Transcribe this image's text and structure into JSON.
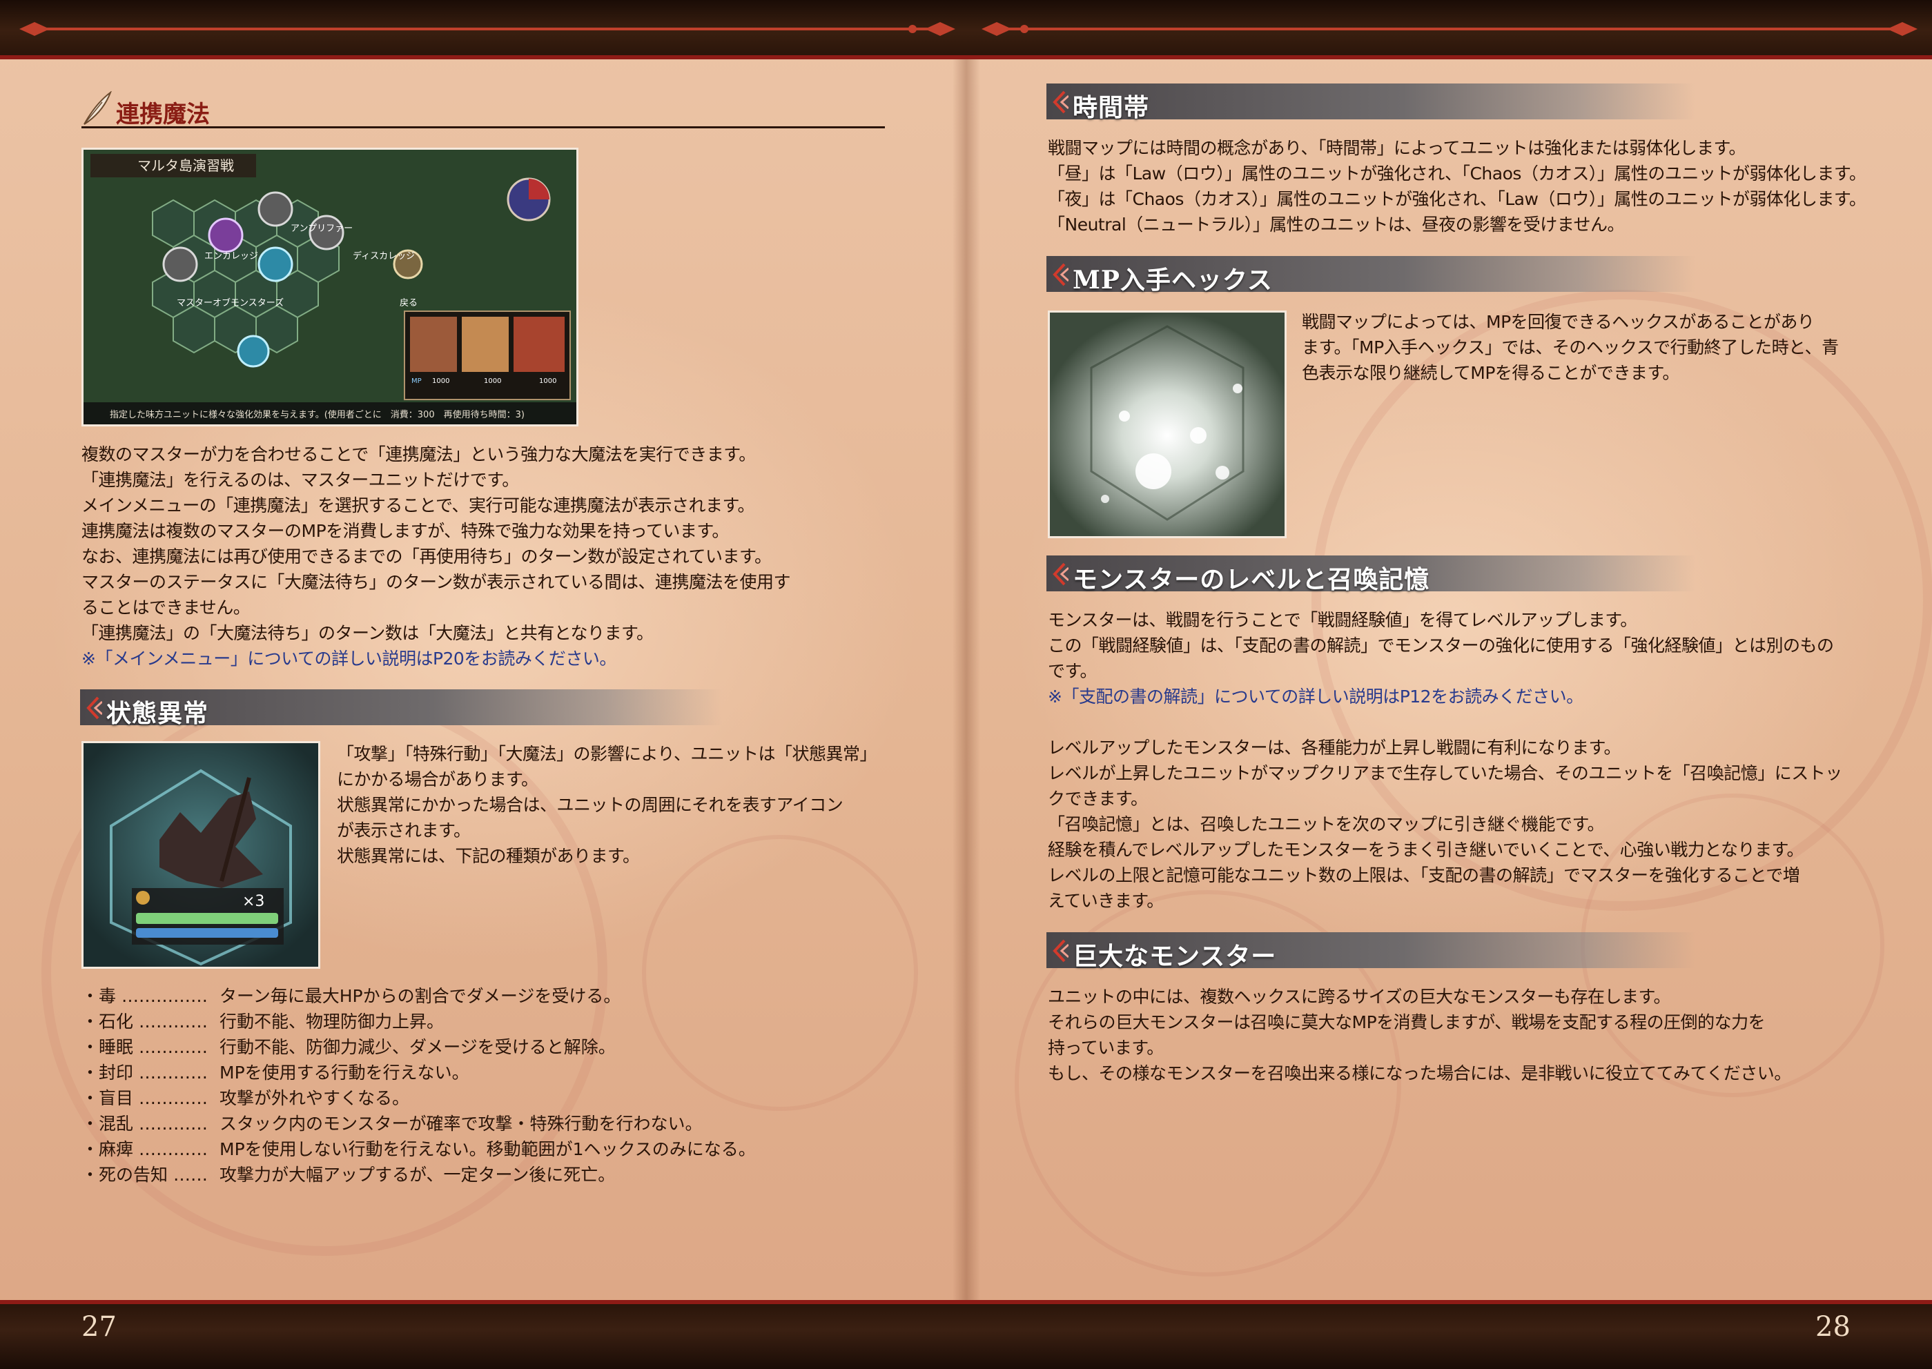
{
  "pages": {
    "left_number": "27",
    "right_number": "28"
  },
  "left": {
    "section1": {
      "title": "連携魔法",
      "screenshot": {
        "title": "マルタ島演習戦",
        "menu": [
          "アンプリファー",
          "エンカレッジ",
          "ディスカレッジ",
          "マスターオブモンスターズ",
          "戻る"
        ],
        "mp_label": "MP",
        "mp_values": [
          "1000",
          "1000",
          "1000"
        ],
        "help": "指定した味方ユニットに様々な強化効果を与えます。(使用者ごとに　消費：300　再使用待ち時間：3)"
      },
      "paragraphs": [
        "複数のマスターが力を合わせることで「連携魔法」という強力な大魔法を実行できます。",
        "「連携魔法」を行えるのは、マスターユニットだけです。",
        "メインメニューの「連携魔法」を選択することで、実行可能な連携魔法が表示されます。",
        "連携魔法は複数のマスターのMPを消費しますが、特殊で強力な効果を持っています。",
        "なお、連携魔法には再び使用できるまでの「再使用待ち」のターン数が設定されています。",
        "マスターのステータスに「大魔法待ち」のターン数が表示されている間は、連携魔法を使用す",
        "ることはできません。",
        "「連携魔法」の「大魔法待ち」のターン数は「大魔法」と共有となります。"
      ],
      "note": "※「メインメニュー」についての詳しい説明はP20をお読みください。"
    },
    "section2": {
      "title": "状態異常",
      "screenshot": {
        "count": "×3"
      },
      "paragraphs": [
        "「攻撃」「特殊行動」「大魔法」の影響により、ユニットは「状態異常」",
        "にかかる場合があります。",
        "状態異常にかかった場合は、ユニットの周囲にそれを表すアイコン",
        "が表示されます。",
        "状態異常には、下記の種類があります。"
      ],
      "statuses": [
        {
          "name": "・毒 ……………",
          "desc": "ターン毎に最大HPからの割合でダメージを受ける。"
        },
        {
          "name": "・石化 …………",
          "desc": "行動不能、物理防御力上昇。"
        },
        {
          "name": "・睡眠 …………",
          "desc": "行動不能、防御力減少、ダメージを受けると解除。"
        },
        {
          "name": "・封印 …………",
          "desc": "MPを使用する行動を行えない。"
        },
        {
          "name": "・盲目 …………",
          "desc": "攻撃が外れやすくなる。"
        },
        {
          "name": "・混乱 …………",
          "desc": "スタック内のモンスターが確率で攻撃・特殊行動を行わない。"
        },
        {
          "name": "・麻痺 …………",
          "desc": "MPを使用しない行動を行えない。移動範囲が1ヘックスのみになる。"
        },
        {
          "name": "・死の告知 ……",
          "desc": "攻撃力が大幅アップするが、一定ターン後に死亡。"
        }
      ]
    }
  },
  "right": {
    "section1": {
      "title": "時間帯",
      "paragraphs": [
        "戦闘マップには時間の概念があり、「時間帯」によってユニットは強化または弱体化します。",
        "「昼」は「Law（ロウ）」属性のユニットが強化され、「Chaos（カオス）」属性のユニットが弱体化します。",
        "「夜」は「Chaos（カオス）」属性のユニットが強化され、「Law（ロウ）」属性のユニットが弱体化します。",
        "「Neutral（ニュートラル）」属性のユニットは、昼夜の影響を受けません。"
      ]
    },
    "section2": {
      "title": "MP入手ヘックス",
      "paragraphs": [
        "戦闘マップによっては、MPを回復できるヘックスがあることがあり",
        "ます。「MP入手ヘックス」では、そのヘックスで行動終了した時と、青",
        "色表示な限り継続してMPを得ることができます。"
      ]
    },
    "section3": {
      "title": "モンスターのレベルと召喚記憶",
      "paragraphs_a": [
        "モンスターは、戦闘を行うことで「戦闘経験値」を得てレベルアップします。",
        "この「戦闘経験値」は、「支配の書の解読」でモンスターの強化に使用する「強化経験値」とは別のもの",
        "です。"
      ],
      "note": "※「支配の書の解読」についての詳しい説明はP12をお読みください。",
      "paragraphs_b": [
        "レベルアップしたモンスターは、各種能力が上昇し戦闘に有利になります。",
        "レベルが上昇したユニットがマップクリアまで生存していた場合、そのユニットを「召喚記憶」にストッ",
        "クできます。",
        "「召喚記憶」とは、召喚したユニットを次のマップに引き継ぐ機能です。",
        "経験を積んでレベルアップしたモンスターをうまく引き継いでいくことで、心強い戦力となります。",
        "レベルの上限と記憶可能なユニット数の上限は、「支配の書の解読」でマスターを強化することで増",
        "えていきます。"
      ]
    },
    "section4": {
      "title": "巨大なモンスター",
      "paragraphs": [
        "ユニットの中には、複数ヘックスに跨るサイズの巨大なモンスターも存在します。",
        "それらの巨大モンスターは召喚に莫大なMPを消費しますが、戦場を支配する程の圧倒的な力を",
        "持っています。",
        "もし、その様なモンスターを召喚出来る様になった場合には、是非戦いに役立ててみてください。"
      ]
    }
  },
  "colors": {
    "accent_red": "#8a1d14",
    "link_blue": "#283a8c",
    "banner_gray": "#5a5657",
    "page_bg": "#e6b999"
  }
}
